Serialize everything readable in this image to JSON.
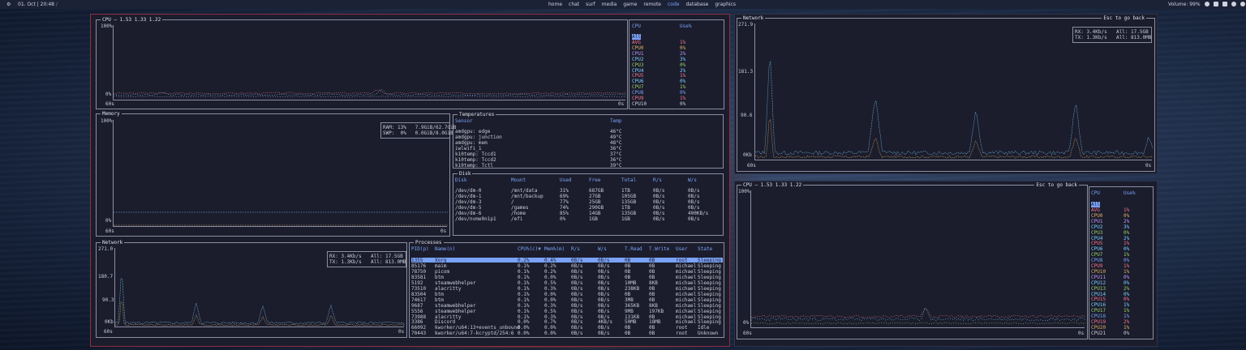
{
  "topbar": {
    "left_icon": "⚙",
    "clock": "01. Oct | 20:48",
    "clock_suffix": "/",
    "workspaces": [
      {
        "label": "home",
        "active": false
      },
      {
        "label": "chat",
        "active": false
      },
      {
        "label": "surf",
        "active": false
      },
      {
        "label": "media",
        "active": false
      },
      {
        "label": "game",
        "active": false
      },
      {
        "label": "remote",
        "active": false
      },
      {
        "label": "code",
        "active": true
      },
      {
        "label": "database",
        "active": false
      },
      {
        "label": "graphics",
        "active": false
      }
    ],
    "volume": "Volume: 99%"
  },
  "colors": {
    "accent": "#7aa2f7",
    "border_focus": "#8f2d40",
    "red": "#f7768e",
    "green": "#9ece6a",
    "cyan": "#7dcfff",
    "yellow": "#e0af68",
    "purple": "#bb9af7",
    "text": "#c8cbd6"
  },
  "cpu_panel": {
    "title": "CPU — 1.53 1.33 1.22",
    "y_max": "100%",
    "y_min": "0%",
    "x_start": "60s",
    "x_end": "0s",
    "legend_header": {
      "cpu": "CPU",
      "use": "Use%"
    },
    "selected": "All",
    "rows": [
      {
        "name": "AVG",
        "use": "1%",
        "color": "#f7768e"
      },
      {
        "name": "CPU0",
        "use": "0%",
        "color": "#e0af68"
      },
      {
        "name": "CPU1",
        "use": "2%",
        "color": "#bb9af7"
      },
      {
        "name": "CPU2",
        "use": "3%",
        "color": "#7dcfff"
      },
      {
        "name": "CPU3",
        "use": "0%",
        "color": "#9ece6a"
      },
      {
        "name": "CPU4",
        "use": "2%",
        "color": "#7dcfff"
      },
      {
        "name": "CPU5",
        "use": "1%",
        "color": "#f7768e"
      },
      {
        "name": "CPU6",
        "use": "0%",
        "color": "#7dcfff"
      },
      {
        "name": "CPU7",
        "use": "1%",
        "color": "#9ece6a"
      },
      {
        "name": "CPU8",
        "use": "0%",
        "color": "#7aa2f7"
      },
      {
        "name": "CPU9",
        "use": "1%",
        "color": "#f7768e"
      },
      {
        "name": "CPU10",
        "use": "0%",
        "color": "#c8cbd6"
      }
    ]
  },
  "memory_panel": {
    "title": "Memory",
    "y_max": "100%",
    "y_min": "0%",
    "x_start": "60s",
    "x_end": "0s",
    "ram": "RAM: 13%   7.9GiB/62.7GiB",
    "swp": "SWP:  0%   0.0GiB/8.0GiB",
    "ram_fraction": 0.13
  },
  "temps": {
    "title": "Temperatures",
    "header": {
      "sensor": "Sensor",
      "temp": "Temp"
    },
    "rows": [
      {
        "sensor": "amdgpu: edge",
        "temp": "46°C"
      },
      {
        "sensor": "amdgpu: junction",
        "temp": "49°C"
      },
      {
        "sensor": "amdgpu: mem",
        "temp": "48°C"
      },
      {
        "sensor": "iwlwifi_1",
        "temp": "36°C"
      },
      {
        "sensor": "k10temp: Tccd1",
        "temp": "37°C"
      },
      {
        "sensor": "k10temp: Tccd2",
        "temp": "36°C"
      },
      {
        "sensor": "k10temp: Tctl",
        "temp": "39°C"
      }
    ]
  },
  "disk": {
    "title": "Disk",
    "header": [
      "Disk",
      "Mount",
      "Used",
      "Free",
      "Total",
      "R/s",
      "W/s"
    ],
    "rows": [
      [
        "/dev/dm-0",
        "/mnt/data",
        "31%",
        "687GB",
        "1TB",
        "0B/s",
        "0B/s"
      ],
      [
        "/dev/dm-1",
        "/mnt/backup",
        "69%",
        "27GB",
        "105GB",
        "0B/s",
        "0B/s"
      ],
      [
        "/dev/dm-3",
        "/",
        "77%",
        "25GB",
        "135GB",
        "0B/s",
        "0B/s"
      ],
      [
        "/dev/dm-5",
        "/games",
        "74%",
        "290GB",
        "1TB",
        "0B/s",
        "0B/s"
      ],
      [
        "/dev/dm-6",
        "/home",
        "85%",
        "14GB",
        "135GB",
        "0B/s",
        "400KB/s"
      ],
      [
        "/dev/nvme0n1p1",
        "/efi",
        "0%",
        "1GB",
        "1GB",
        "0B/s",
        "0B/s"
      ]
    ]
  },
  "network_small": {
    "title": "Network",
    "y_labels": [
      "271.0",
      "180.7",
      "90.3",
      "0Kb"
    ],
    "x_start": "60s",
    "x_end": "0s",
    "rx": "RX: 3.4Kb/s",
    "rx_all": "All: 17.5GB",
    "tx": "TX: 1.3Kb/s",
    "tx_all": "All: 813.0MB"
  },
  "processes": {
    "title": "Processes",
    "header": [
      "PID(p)",
      "Name(n)",
      "CPU%(c)▼",
      "Mem%(m)",
      "R/s",
      "W/s",
      "T.Read",
      "T.Write",
      "User",
      "State"
    ],
    "rows": [
      [
        "1355",
        "Xorg",
        "0.2%",
        "0.4%",
        "0B/s",
        "0B/s",
        "0B",
        "0B",
        "root",
        "Sleeping"
      ],
      [
        "85176",
        "maim",
        "0.1%",
        "0.2%",
        "0B/s",
        "0B/s",
        "0B",
        "0B",
        "michael",
        "Sleeping"
      ],
      [
        "78750",
        "picom",
        "0.1%",
        "0.2%",
        "0B/s",
        "0B/s",
        "0B",
        "0B",
        "michael",
        "Sleeping"
      ],
      [
        "83581",
        "btm",
        "0.1%",
        "0.0%",
        "0B/s",
        "0B/s",
        "0B",
        "0B",
        "michael",
        "Sleeping"
      ],
      [
        "5192",
        "steamwebhelper",
        "0.1%",
        "0.5%",
        "0B/s",
        "0B/s",
        "10MB",
        "8KB",
        "michael",
        "Sleeping"
      ],
      [
        "73510",
        "alacritty",
        "0.1%",
        "0.3%",
        "0B/s",
        "0B/s",
        "238KB",
        "0B",
        "michael",
        "Sleeping"
      ],
      [
        "83504",
        "btm",
        "0.1%",
        "0.0%",
        "0B/s",
        "0B/s",
        "0B",
        "0B",
        "michael",
        "Sleeping"
      ],
      [
        "74617",
        "btm",
        "0.1%",
        "0.0%",
        "0B/s",
        "0B/s",
        "3MB",
        "0B",
        "michael",
        "Sleeping"
      ],
      [
        "9687",
        "steamwebhelper",
        "0.1%",
        "0.3%",
        "0B/s",
        "0B/s",
        "365KB",
        "8KB",
        "michael",
        "Sleeping"
      ],
      [
        "5556",
        "steamwebhelper",
        "0.1%",
        "0.5%",
        "0B/s",
        "0B/s",
        "9MB",
        "197KB",
        "michael",
        "Sleeping"
      ],
      [
        "73988",
        "alacritty",
        "0.1%",
        "0.3%",
        "0B/s",
        "0B/s",
        "131KB",
        "0B",
        "michael",
        "Sleeping"
      ],
      [
        "3386",
        "Discord",
        "0.0%",
        "0.7%",
        "0B/s",
        "4KB/s",
        "50MB",
        "18MB",
        "michael",
        "Sleeping"
      ],
      [
        "66092",
        "kworker/u64:13+events_unbound",
        "0.0%",
        "0.0%",
        "0B/s",
        "0B/s",
        "0B",
        "0B",
        "root",
        "Idle"
      ],
      [
        "70443",
        "kworker/u64:7-kcryptd/254:6",
        "0.0%",
        "0.0%",
        "0B/s",
        "0B/s",
        "0B",
        "0B",
        "root",
        "Unknown"
      ]
    ]
  },
  "network_big": {
    "title": "Network",
    "esc": "Esc to go back",
    "y_labels": [
      "271.9",
      "181.3",
      "90.6",
      "0Kb"
    ],
    "x_start": "60s",
    "x_end": "0s",
    "rx": "RX: 3.4Kb/s",
    "rx_all": "All: 17.5GB",
    "tx": "TX: 1.3Kb/s",
    "tx_all": "All: 813.0MB"
  },
  "cpu_big": {
    "title": "CPU — 1.53 1.33 1.22",
    "esc": "Esc to go back",
    "y_max": "100%",
    "y_min": "0%",
    "x_start": "60s",
    "x_end": "0s",
    "legend_header": {
      "cpu": "CPU",
      "use": "Use%"
    },
    "selected": "All",
    "rows": [
      {
        "name": "AVG",
        "use": "1%",
        "color": "#f7768e"
      },
      {
        "name": "CPU0",
        "use": "0%",
        "color": "#e0af68"
      },
      {
        "name": "CPU1",
        "use": "2%",
        "color": "#bb9af7"
      },
      {
        "name": "CPU2",
        "use": "3%",
        "color": "#7dcfff"
      },
      {
        "name": "CPU3",
        "use": "0%",
        "color": "#9ece6a"
      },
      {
        "name": "CPU4",
        "use": "2%",
        "color": "#7dcfff"
      },
      {
        "name": "CPU5",
        "use": "1%",
        "color": "#f7768e"
      },
      {
        "name": "CPU6",
        "use": "0%",
        "color": "#7dcfff"
      },
      {
        "name": "CPU7",
        "use": "1%",
        "color": "#9ece6a"
      },
      {
        "name": "CPU8",
        "use": "0%",
        "color": "#7aa2f7"
      },
      {
        "name": "CPU9",
        "use": "1%",
        "color": "#f7768e"
      },
      {
        "name": "CPU10",
        "use": "1%",
        "color": "#e0af68"
      },
      {
        "name": "CPU11",
        "use": "0%",
        "color": "#bb9af7"
      },
      {
        "name": "CPU12",
        "use": "0%",
        "color": "#7dcfff"
      },
      {
        "name": "CPU13",
        "use": "2%",
        "color": "#9ece6a"
      },
      {
        "name": "CPU14",
        "use": "0%",
        "color": "#7dcfff"
      },
      {
        "name": "CPU15",
        "use": "0%",
        "color": "#f7768e"
      },
      {
        "name": "CPU16",
        "use": "1%",
        "color": "#7dcfff"
      },
      {
        "name": "CPU17",
        "use": "1%",
        "color": "#9ece6a"
      },
      {
        "name": "CPU18",
        "use": "1%",
        "color": "#7aa2f7"
      },
      {
        "name": "CPU19",
        "use": "2%",
        "color": "#f7768e"
      },
      {
        "name": "CPU20",
        "use": "1%",
        "color": "#e0af68"
      },
      {
        "name": "CPU21",
        "use": "0%",
        "color": "#c8cbd6"
      }
    ]
  }
}
